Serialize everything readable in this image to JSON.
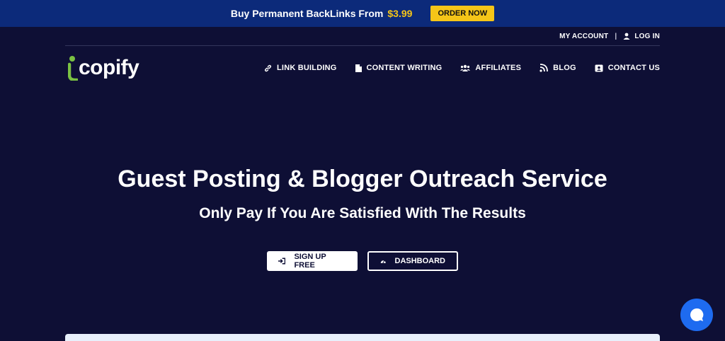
{
  "promo": {
    "text": "Buy Permanent BackLinks From",
    "price": "$3.99",
    "cta": "ORDER NOW"
  },
  "account": {
    "my_account": "MY ACCOUNT",
    "separator": "|",
    "login": "LOG IN"
  },
  "logo": {
    "text": "copify",
    "brand_color": "#7ac143"
  },
  "nav": [
    {
      "label": "LINK BUILDING",
      "icon": "link-icon"
    },
    {
      "label": "CONTENT WRITING",
      "icon": "document-icon"
    },
    {
      "label": "AFFILIATES",
      "icon": "users-icon"
    },
    {
      "label": "BLOG",
      "icon": "rss-icon"
    },
    {
      "label": "CONTACT US",
      "icon": "contact-card-icon"
    }
  ],
  "hero": {
    "title": "Guest Posting & Blogger Outreach Service",
    "subtitle": "Only Pay If You Are Satisfied With The Results",
    "signup_label": "SIGN UP FREE",
    "dashboard_label": "DASHBOARD"
  },
  "colors": {
    "background": "#0e0f35",
    "promo_bar": "#0c2a7a",
    "accent_yellow": "#f5c518",
    "chat_blue": "#1e6bf0"
  }
}
